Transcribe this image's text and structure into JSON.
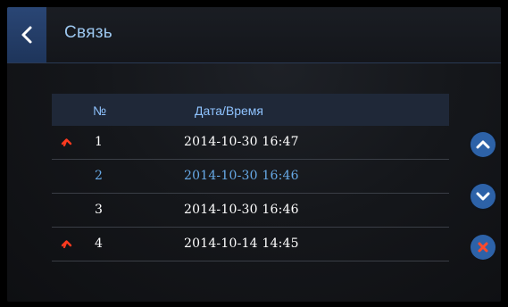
{
  "header": {
    "title": "Связь",
    "back_icon": "chevron-left-icon"
  },
  "table": {
    "columns": [
      "№",
      "Дата/Время"
    ],
    "rows": [
      {
        "number": "1",
        "datetime": "2014-10-30  16:47",
        "status": "missed-call-icon",
        "highlighted": false
      },
      {
        "number": "2",
        "datetime": "2014-10-30  16:46",
        "status": "",
        "highlighted": true
      },
      {
        "number": "3",
        "datetime": "2014-10-30  16:46",
        "status": "",
        "highlighted": false
      },
      {
        "number": "4",
        "datetime": "2014-10-14  14:45",
        "status": "missed-call-icon",
        "highlighted": false
      }
    ]
  },
  "side_buttons": {
    "up_icon": "chevron-up-icon",
    "down_icon": "chevron-down-icon",
    "delete_icon": "close-icon"
  },
  "colors": {
    "accent": "#2d62a8",
    "highlight_text": "#67a9e6",
    "missed_icon": "#ff3a1f",
    "delete_x": "#ff4a2a"
  }
}
